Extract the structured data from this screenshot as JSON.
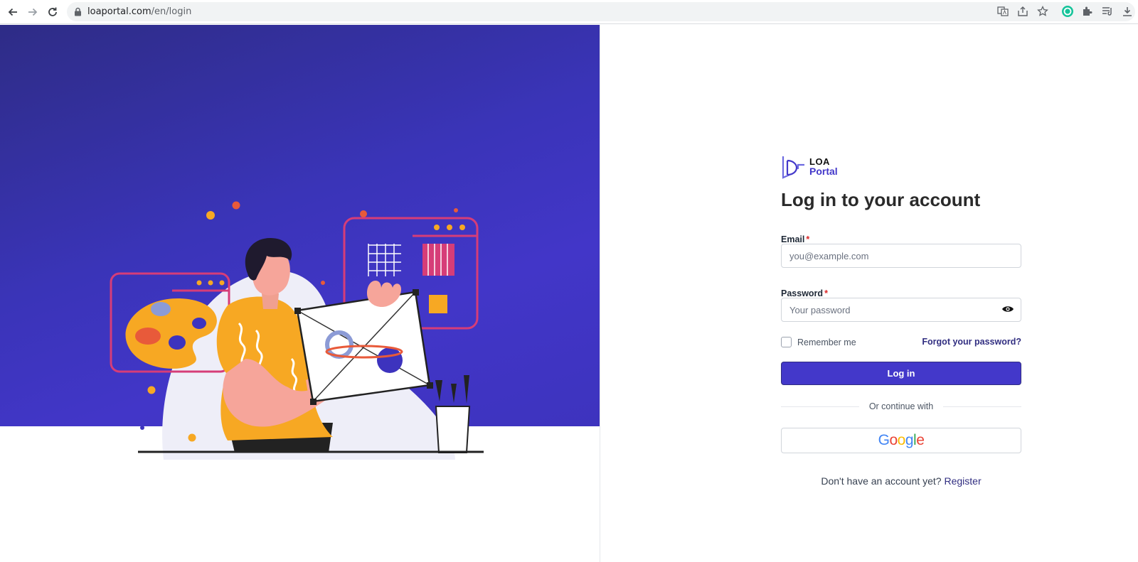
{
  "browser": {
    "url_host": "loaportal.com",
    "url_path": "/en/login"
  },
  "logo": {
    "line1": "LOA",
    "line2": "Portal"
  },
  "login": {
    "title": "Log in to your account",
    "email_label": "Email",
    "email_placeholder": "you@example.com",
    "password_label": "Password",
    "password_placeholder": "Your password",
    "required_mark": "*",
    "remember_label": "Remember me",
    "forgot_label": "Forgot your password?",
    "submit_label": "Log in",
    "divider_text": "Or continue with",
    "google_label": "Google",
    "no_account_text": "Don't have an account yet?",
    "register_label": "Register"
  },
  "colors": {
    "accent": "#4338ca",
    "link": "#312e81",
    "required": "#dc2626",
    "hero_background": "#3a34b8"
  },
  "icons": [
    "back-icon",
    "forward-icon",
    "reload-icon",
    "lock-icon",
    "translate-icon",
    "share-icon",
    "star-icon",
    "grammarly-icon",
    "extensions-icon",
    "reading-list-icon",
    "download-icon",
    "eye-icon"
  ]
}
